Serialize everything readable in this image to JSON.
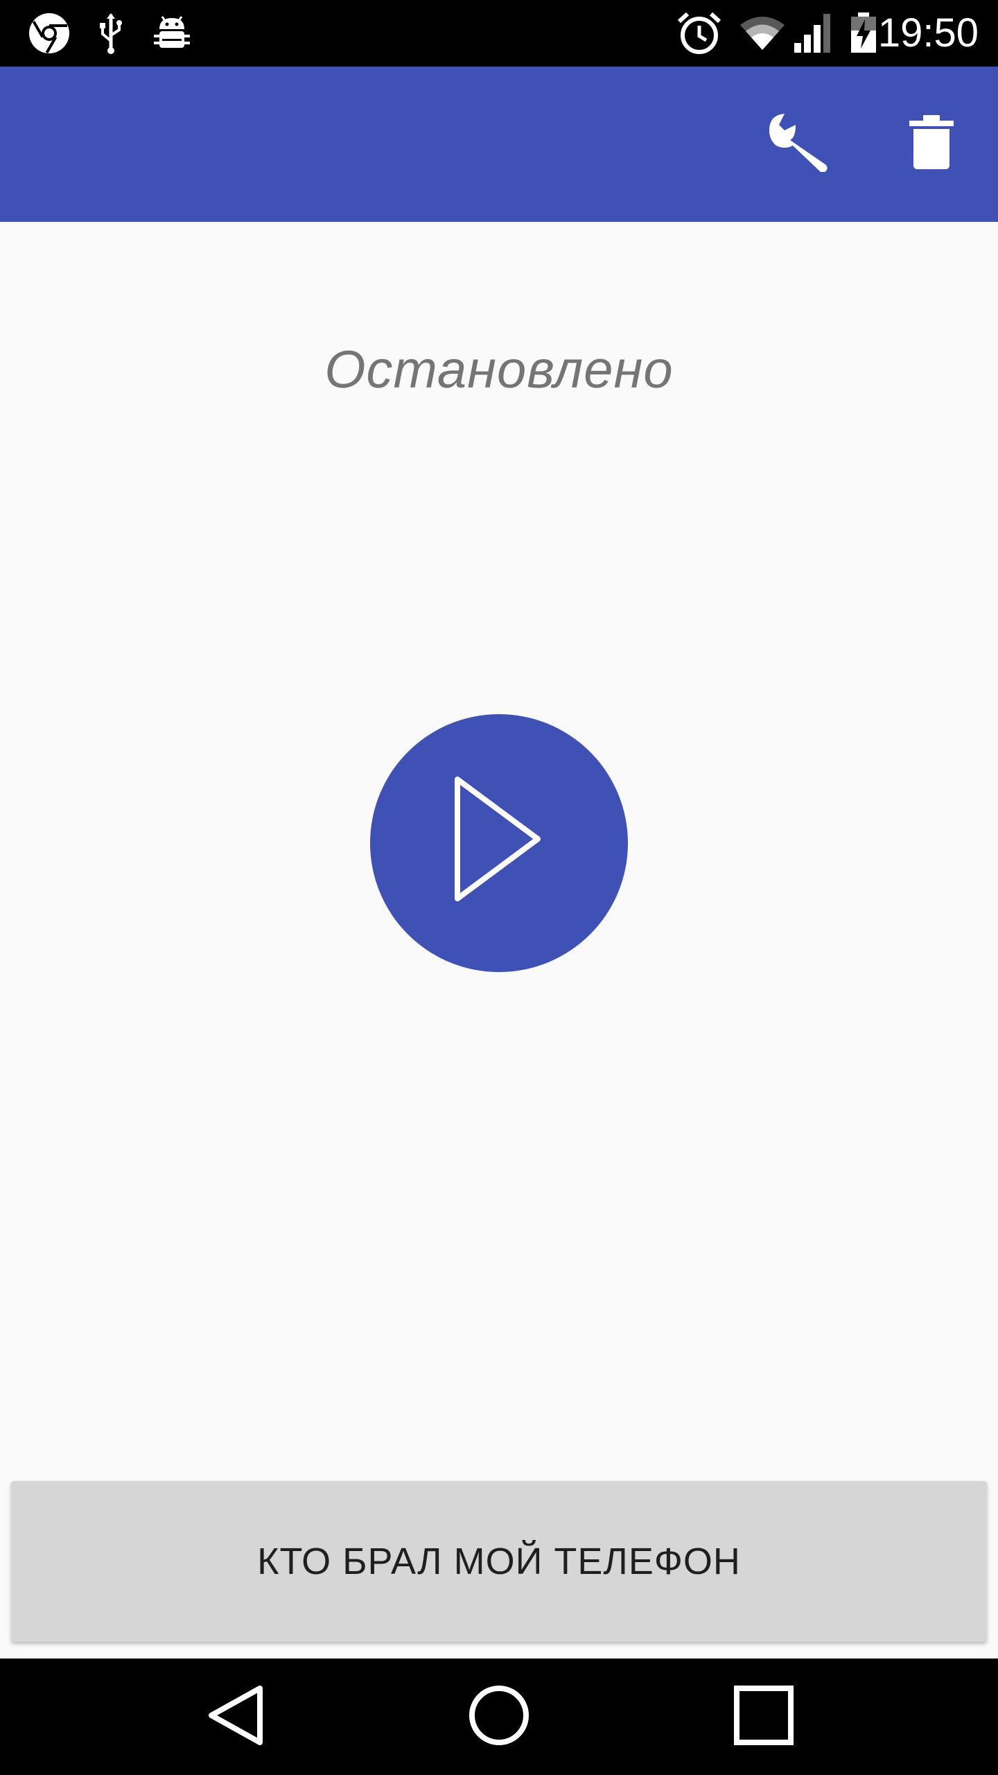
{
  "status_bar": {
    "time": "19:50",
    "left_icons": [
      "chrome-icon",
      "usb-icon",
      "android-debug-icon"
    ],
    "right_icons": [
      "alarm-icon",
      "wifi-icon",
      "signal-icon",
      "battery-charging-icon"
    ]
  },
  "app_bar": {
    "color": "#3f51b5",
    "actions": [
      "wrench-icon",
      "trash-icon"
    ]
  },
  "main": {
    "status_text": "Остановлено",
    "play_button_icon": "play-icon",
    "play_button_color": "#3f51b5"
  },
  "bottom_button": {
    "label": "КТО БРАЛ МОЙ ТЕЛЕФОН"
  },
  "nav_bar": {
    "buttons": [
      "back-icon",
      "home-icon",
      "recents-icon"
    ]
  }
}
